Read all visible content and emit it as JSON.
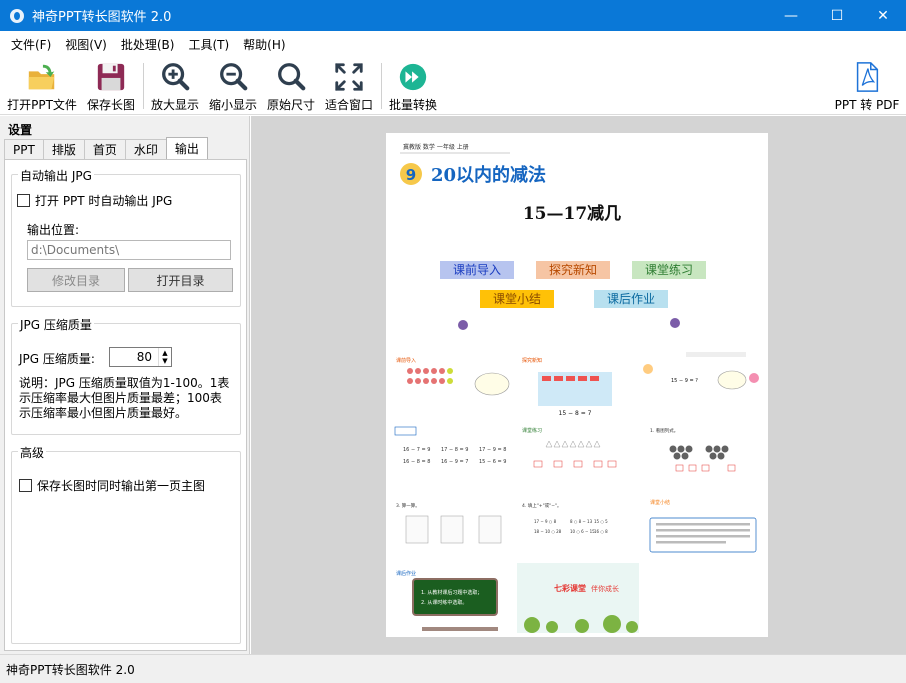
{
  "window": {
    "title": "神奇PPT转长图软件 2.0",
    "minimize": "—",
    "maximize": "☐",
    "close": "✕"
  },
  "menu": [
    "文件(F)",
    "视图(V)",
    "批处理(B)",
    "工具(T)",
    "帮助(H)"
  ],
  "toolbar": {
    "open_ppt": "打开PPT文件",
    "save_long": "保存长图",
    "zoom_in": "放大显示",
    "zoom_out": "缩小显示",
    "original_size": "原始尺寸",
    "fit_window": "适合窗口",
    "batch_convert": "批量转换",
    "ppt_to_pdf": "PPT 转 PDF"
  },
  "settings": {
    "title": "设置",
    "tabs": [
      "PPT",
      "排版",
      "首页",
      "水印",
      "输出"
    ],
    "active_tab": "输出",
    "auto_jpg": {
      "group_title": "自动输出 JPG",
      "checkbox_label": "打开 PPT 时自动输出 JPG",
      "checked": false,
      "location_label": "输出位置:",
      "location_value": "d:\\Documents\\",
      "modify_dir": "修改目录",
      "open_dir": "打开目录"
    },
    "jpg_quality": {
      "group_title": "JPG 压缩质量",
      "label": "JPG 压缩质量:",
      "value": "80",
      "description": "说明：JPG 压缩质量取值为1-100。1表\n示压缩率最大但图片质量最差；100表\n示压缩率最小但图片质量最好。"
    },
    "advanced": {
      "group_title": "高级",
      "checkbox_label": "保存长图时同时输出第一页主图",
      "checked": false
    }
  },
  "preview": {
    "header_text": "冀教版  数学  一年级  上册",
    "chapter_number": "9",
    "chapter_title": "20以内的减法",
    "subtitle": "15—17减几",
    "tags": [
      "课前导入",
      "探究新知",
      "课堂练习",
      "课堂小结",
      "课后作业"
    ],
    "thumbs": {
      "t1": "课前导入",
      "t2": "探究新知",
      "t2_eq": "15 − 8 = 7",
      "t3_eq": "15 − 9 = ?",
      "t4": "课堂练习",
      "t5": "1. 看图列式。",
      "t6": "3. 算一算。",
      "t7": "4. 填上\"+\"或\"−\"。",
      "t8": "课堂小结",
      "t9": "课后作业",
      "t10_brand": "七彩课堂",
      "t10_slogan": "伴你成长",
      "hw1": "1. 从教材课后习题中选取；",
      "hw2": "2. 从课时练中选取。"
    }
  },
  "statusbar": {
    "text": "神奇PPT转长图软件 2.0"
  },
  "colors": {
    "titlebar": "#0a78d7",
    "accent_blue": "#1565c0",
    "orange": "#ff9800"
  }
}
